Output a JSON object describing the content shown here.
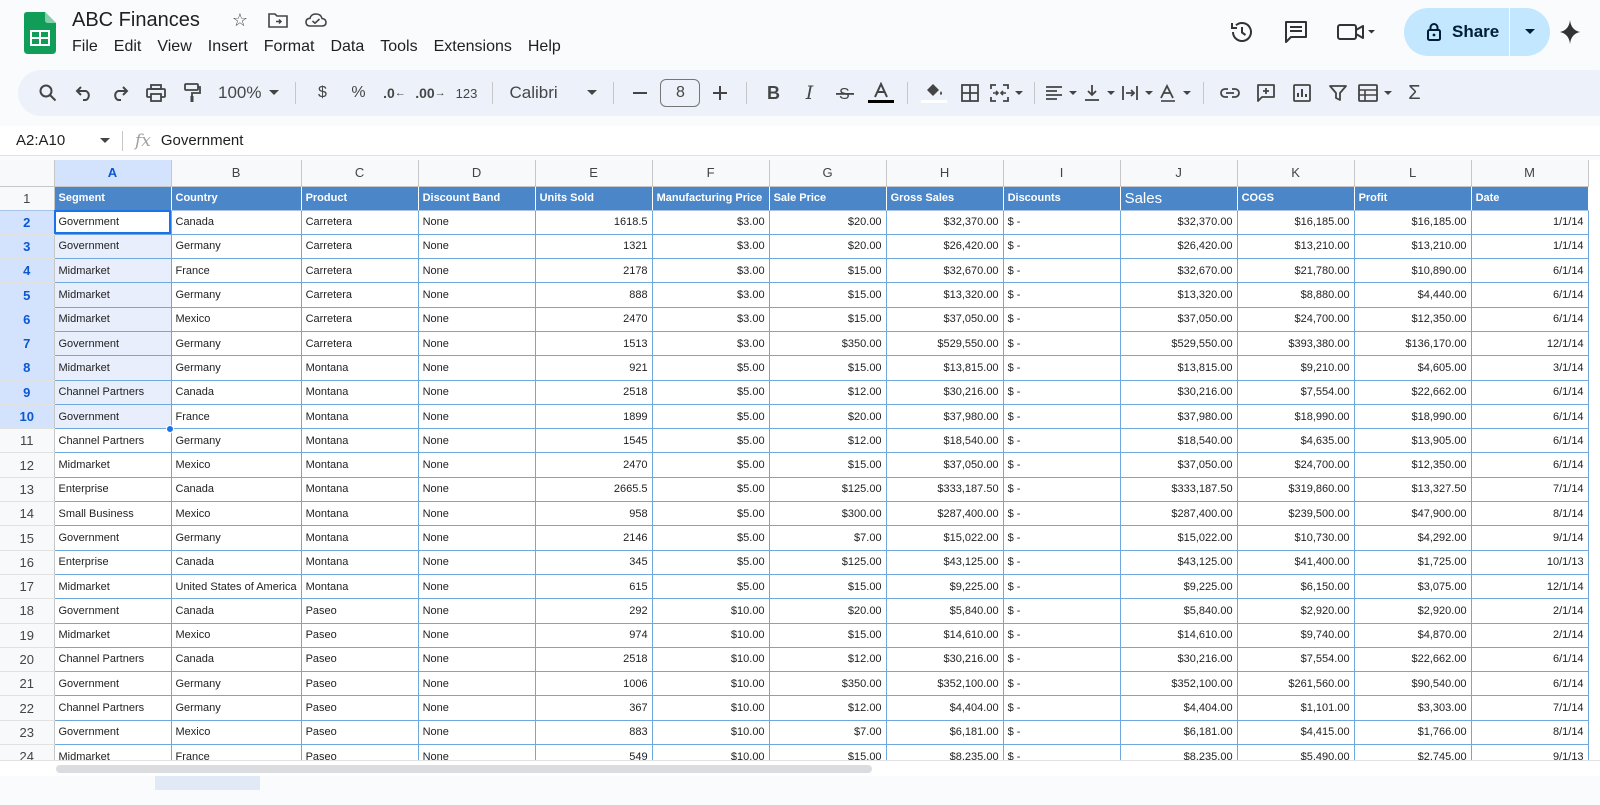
{
  "app": {
    "title": "ABC Finances",
    "menu": [
      "File",
      "Edit",
      "View",
      "Insert",
      "Format",
      "Data",
      "Tools",
      "Extensions",
      "Help"
    ],
    "title_icons": [
      "star-icon",
      "move-to-folder-icon",
      "cloud-saved-icon"
    ],
    "share_label": "Share",
    "colors": {
      "accent": "#1a73e8",
      "share_bg": "#c2e7ff",
      "header_blue": "#4a86c8",
      "sheets_green": "#0f9d58"
    }
  },
  "toolbar": {
    "zoom": "100%",
    "currency": "$",
    "percent": "%",
    "dec_decrease": ".0",
    "dec_increase": ".00",
    "more_formats": "123",
    "font": "Calibri",
    "font_size": "8"
  },
  "formula": {
    "name_box": "A2:A10",
    "fx": "fx",
    "value": "Government"
  },
  "grid": {
    "columns": [
      "A",
      "B",
      "C",
      "D",
      "E",
      "F",
      "G",
      "H",
      "I",
      "J",
      "K",
      "L",
      "M"
    ],
    "headers": [
      "Segment",
      "Country",
      "Product",
      "Discount Band",
      "Units Sold",
      "Manufacturing Price",
      "Sale Price",
      "Gross Sales",
      "Discounts",
      "Sales",
      "COGS",
      "Profit",
      "Date"
    ],
    "rows": [
      [
        "Government",
        "Canada",
        "Carretera",
        "None",
        "1618.5",
        "$3.00",
        "$20.00",
        "$32,370.00",
        "$ -",
        "$32,370.00",
        "$16,185.00",
        "$16,185.00",
        "1/1/14"
      ],
      [
        "Government",
        "Germany",
        "Carretera",
        "None",
        "1321",
        "$3.00",
        "$20.00",
        "$26,420.00",
        "$ -",
        "$26,420.00",
        "$13,210.00",
        "$13,210.00",
        "1/1/14"
      ],
      [
        "Midmarket",
        "France",
        "Carretera",
        "None",
        "2178",
        "$3.00",
        "$15.00",
        "$32,670.00",
        "$ -",
        "$32,670.00",
        "$21,780.00",
        "$10,890.00",
        "6/1/14"
      ],
      [
        "Midmarket",
        "Germany",
        "Carretera",
        "None",
        "888",
        "$3.00",
        "$15.00",
        "$13,320.00",
        "$ -",
        "$13,320.00",
        "$8,880.00",
        "$4,440.00",
        "6/1/14"
      ],
      [
        "Midmarket",
        "Mexico",
        "Carretera",
        "None",
        "2470",
        "$3.00",
        "$15.00",
        "$37,050.00",
        "$ -",
        "$37,050.00",
        "$24,700.00",
        "$12,350.00",
        "6/1/14"
      ],
      [
        "Government",
        "Germany",
        "Carretera",
        "None",
        "1513",
        "$3.00",
        "$350.00",
        "$529,550.00",
        "$ -",
        "$529,550.00",
        "$393,380.00",
        "$136,170.00",
        "12/1/14"
      ],
      [
        "Midmarket",
        "Germany",
        "Montana",
        "None",
        "921",
        "$5.00",
        "$15.00",
        "$13,815.00",
        "$ -",
        "$13,815.00",
        "$9,210.00",
        "$4,605.00",
        "3/1/14"
      ],
      [
        "Channel Partners",
        "Canada",
        "Montana",
        "None",
        "2518",
        "$5.00",
        "$12.00",
        "$30,216.00",
        "$ -",
        "$30,216.00",
        "$7,554.00",
        "$22,662.00",
        "6/1/14"
      ],
      [
        "Government",
        "France",
        "Montana",
        "None",
        "1899",
        "$5.00",
        "$20.00",
        "$37,980.00",
        "$ -",
        "$37,980.00",
        "$18,990.00",
        "$18,990.00",
        "6/1/14"
      ],
      [
        "Channel Partners",
        "Germany",
        "Montana",
        "None",
        "1545",
        "$5.00",
        "$12.00",
        "$18,540.00",
        "$ -",
        "$18,540.00",
        "$4,635.00",
        "$13,905.00",
        "6/1/14"
      ],
      [
        "Midmarket",
        "Mexico",
        "Montana",
        "None",
        "2470",
        "$5.00",
        "$15.00",
        "$37,050.00",
        "$ -",
        "$37,050.00",
        "$24,700.00",
        "$12,350.00",
        "6/1/14"
      ],
      [
        "Enterprise",
        "Canada",
        "Montana",
        "None",
        "2665.5",
        "$5.00",
        "$125.00",
        "$333,187.50",
        "$ -",
        "$333,187.50",
        "$319,860.00",
        "$13,327.50",
        "7/1/14"
      ],
      [
        "Small Business",
        "Mexico",
        "Montana",
        "None",
        "958",
        "$5.00",
        "$300.00",
        "$287,400.00",
        "$ -",
        "$287,400.00",
        "$239,500.00",
        "$47,900.00",
        "8/1/14"
      ],
      [
        "Government",
        "Germany",
        "Montana",
        "None",
        "2146",
        "$5.00",
        "$7.00",
        "$15,022.00",
        "$ -",
        "$15,022.00",
        "$10,730.00",
        "$4,292.00",
        "9/1/14"
      ],
      [
        "Enterprise",
        "Canada",
        "Montana",
        "None",
        "345",
        "$5.00",
        "$125.00",
        "$43,125.00",
        "$ -",
        "$43,125.00",
        "$41,400.00",
        "$1,725.00",
        "10/1/13"
      ],
      [
        "Midmarket",
        "United States of America",
        "Montana",
        "None",
        "615",
        "$5.00",
        "$15.00",
        "$9,225.00",
        "$ -",
        "$9,225.00",
        "$6,150.00",
        "$3,075.00",
        "12/1/14"
      ],
      [
        "Government",
        "Canada",
        "Paseo",
        "None",
        "292",
        "$10.00",
        "$20.00",
        "$5,840.00",
        "$ -",
        "$5,840.00",
        "$2,920.00",
        "$2,920.00",
        "2/1/14"
      ],
      [
        "Midmarket",
        "Mexico",
        "Paseo",
        "None",
        "974",
        "$10.00",
        "$15.00",
        "$14,610.00",
        "$ -",
        "$14,610.00",
        "$9,740.00",
        "$4,870.00",
        "2/1/14"
      ],
      [
        "Channel Partners",
        "Canada",
        "Paseo",
        "None",
        "2518",
        "$10.00",
        "$12.00",
        "$30,216.00",
        "$ -",
        "$30,216.00",
        "$7,554.00",
        "$22,662.00",
        "6/1/14"
      ],
      [
        "Government",
        "Germany",
        "Paseo",
        "None",
        "1006",
        "$10.00",
        "$350.00",
        "$352,100.00",
        "$ -",
        "$352,100.00",
        "$261,560.00",
        "$90,540.00",
        "6/1/14"
      ],
      [
        "Channel Partners",
        "Germany",
        "Paseo",
        "None",
        "367",
        "$10.00",
        "$12.00",
        "$4,404.00",
        "$ -",
        "$4,404.00",
        "$1,101.00",
        "$3,303.00",
        "7/1/14"
      ],
      [
        "Government",
        "Mexico",
        "Paseo",
        "None",
        "883",
        "$10.00",
        "$7.00",
        "$6,181.00",
        "$ -",
        "$6,181.00",
        "$4,415.00",
        "$1,766.00",
        "8/1/14"
      ],
      [
        "Midmarket",
        "France",
        "Paseo",
        "None",
        "549",
        "$10.00",
        "$15.00",
        "$8,235.00",
        "$ -",
        "$8,235.00",
        "$5,490.00",
        "$2,745.00",
        "9/1/13"
      ]
    ]
  }
}
